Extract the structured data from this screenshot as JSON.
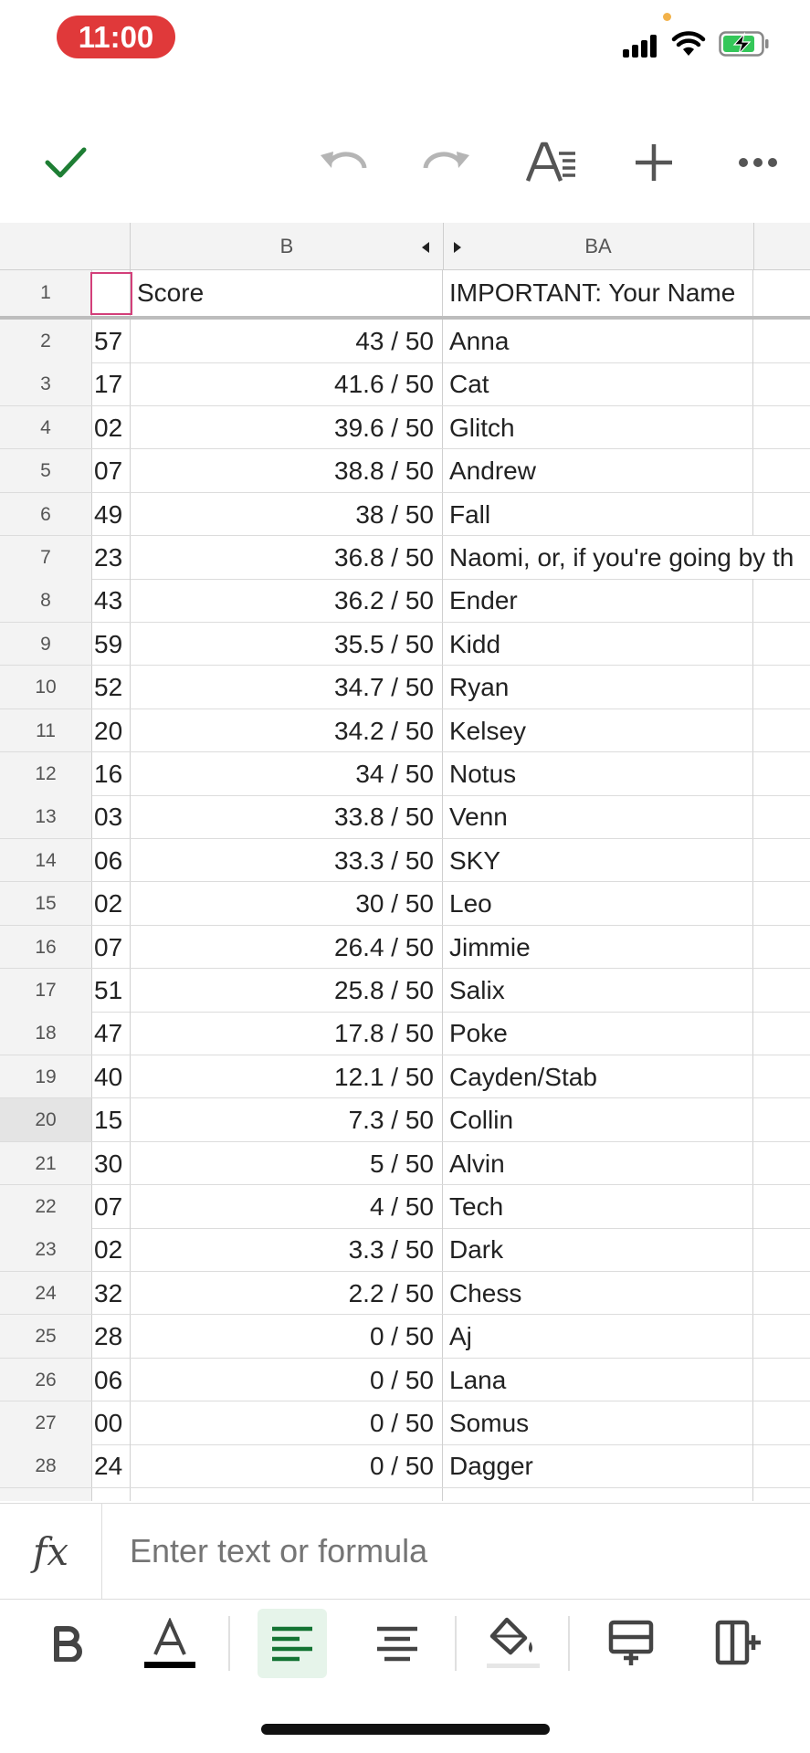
{
  "status_bar": {
    "time": "11:00",
    "icons": [
      "signal-icon",
      "wifi-icon",
      "battery-charging-icon"
    ]
  },
  "toolbar": {
    "icons": [
      "checkmark-icon",
      "undo-icon",
      "redo-icon",
      "text-format-icon",
      "add-icon",
      "more-icon"
    ]
  },
  "grid": {
    "columns": [
      {
        "label": ""
      },
      {
        "label": "B"
      },
      {
        "label": "BA"
      }
    ],
    "header_row": {
      "number": "1",
      "a": "",
      "b": "Score",
      "ba": "IMPORTANT: Your Name"
    },
    "rows": [
      {
        "number": "2",
        "a": "57",
        "b": "43 / 50",
        "ba": "Anna"
      },
      {
        "number": "3",
        "a": "17",
        "b": "41.6 / 50",
        "ba": "Cat"
      },
      {
        "number": "4",
        "a": "02",
        "b": "39.6 / 50",
        "ba": "Glitch"
      },
      {
        "number": "5",
        "a": "07",
        "b": "38.8 / 50",
        "ba": "Andrew"
      },
      {
        "number": "6",
        "a": "49",
        "b": "38 / 50",
        "ba": "Fall"
      },
      {
        "number": "7",
        "a": "23",
        "b": "36.8 / 50",
        "ba": "Naomi, or, if you're going by th"
      },
      {
        "number": "8",
        "a": "43",
        "b": "36.2 / 50",
        "ba": "Ender"
      },
      {
        "number": "9",
        "a": "59",
        "b": "35.5 / 50",
        "ba": "Kidd"
      },
      {
        "number": "10",
        "a": "52",
        "b": "34.7 / 50",
        "ba": "Ryan"
      },
      {
        "number": "11",
        "a": "20",
        "b": "34.2 / 50",
        "ba": "Kelsey"
      },
      {
        "number": "12",
        "a": "16",
        "b": "34 / 50",
        "ba": "Notus"
      },
      {
        "number": "13",
        "a": "03",
        "b": "33.8 / 50",
        "ba": "Venn"
      },
      {
        "number": "14",
        "a": "06",
        "b": "33.3 / 50",
        "ba": "SKY"
      },
      {
        "number": "15",
        "a": "02",
        "b": "30 / 50",
        "ba": "Leo"
      },
      {
        "number": "16",
        "a": "07",
        "b": "26.4 / 50",
        "ba": "Jimmie"
      },
      {
        "number": "17",
        "a": "51",
        "b": "25.8 / 50",
        "ba": "Salix"
      },
      {
        "number": "18",
        "a": "47",
        "b": "17.8 / 50",
        "ba": "Poke"
      },
      {
        "number": "19",
        "a": "40",
        "b": "12.1 / 50",
        "ba": "Cayden/Stab"
      },
      {
        "number": "20",
        "a": "15",
        "b": "7.3 / 50",
        "ba": "Collin"
      },
      {
        "number": "21",
        "a": "30",
        "b": "5 / 50",
        "ba": "Alvin"
      },
      {
        "number": "22",
        "a": "07",
        "b": "4 / 50",
        "ba": "Tech"
      },
      {
        "number": "23",
        "a": "02",
        "b": "3.3 / 50",
        "ba": "Dark"
      },
      {
        "number": "24",
        "a": "32",
        "b": "2.2 / 50",
        "ba": "Chess"
      },
      {
        "number": "25",
        "a": "28",
        "b": "0 / 50",
        "ba": "Aj"
      },
      {
        "number": "26",
        "a": "06",
        "b": "0 / 50",
        "ba": "Lana"
      },
      {
        "number": "27",
        "a": "00",
        "b": "0 / 50",
        "ba": "Somus"
      },
      {
        "number": "28",
        "a": "24",
        "b": "0 / 50",
        "ba": "Dagger"
      }
    ]
  },
  "formula_bar": {
    "icon": "fx-icon",
    "placeholder": "Enter text or formula"
  },
  "format_bar": {
    "icons": [
      "bold-icon",
      "text-color-icon",
      "align-left-icon",
      "align-center-icon",
      "fill-color-icon",
      "insert-row-icon",
      "insert-column-icon"
    ]
  },
  "colors": {
    "accent_green": "#1e7e34",
    "selection_pink": "#d33f7a",
    "time_pill_red": "#e0393a"
  }
}
